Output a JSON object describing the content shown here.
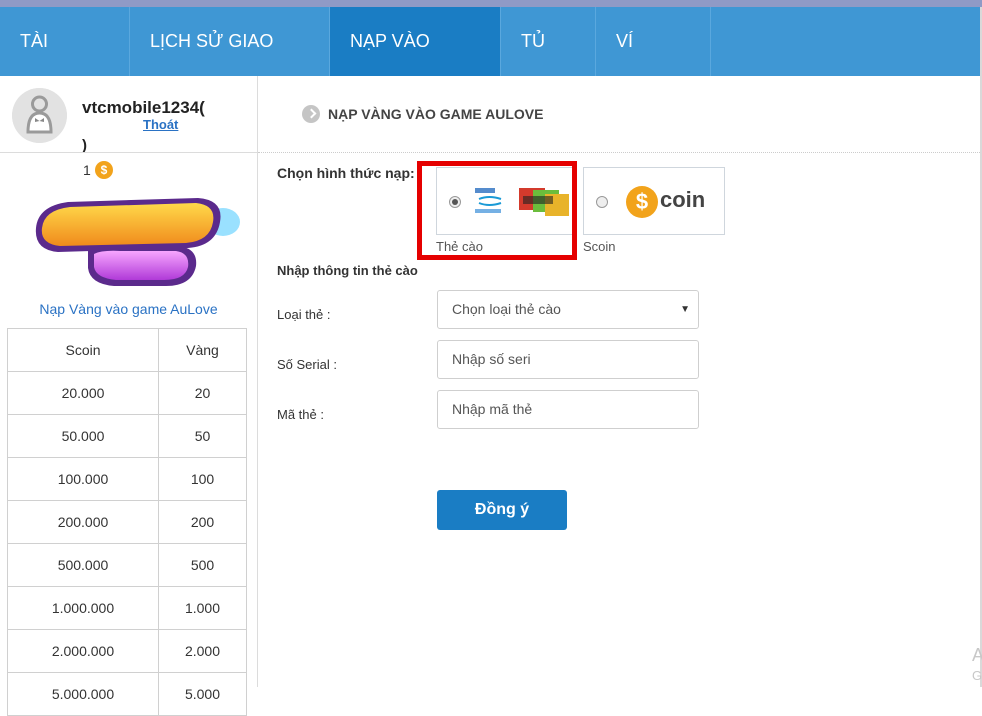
{
  "nav": {
    "items": [
      {
        "label": "TÀI KHOẢN"
      },
      {
        "label": "LỊCH SỬ GIAO DỊCH"
      },
      {
        "label": "NẠP VÀO GAME"
      },
      {
        "label": "TỦ ĐỒ"
      },
      {
        "label": "VÍ SCOIN"
      }
    ],
    "active_index": 2
  },
  "user": {
    "name": "vtcmobile1234(",
    "logout_label": "Thoát",
    "name_close": ")",
    "coin_balance": "1",
    "coin_symbol": "$"
  },
  "sidebar": {
    "game_link": "Nạp Vàng vào game AuLove",
    "table_headers": [
      "Scoin",
      "Vàng"
    ],
    "rates": [
      [
        "20.000",
        "20"
      ],
      [
        "50.000",
        "50"
      ],
      [
        "100.000",
        "100"
      ],
      [
        "200.000",
        "200"
      ],
      [
        "500.000",
        "500"
      ],
      [
        "1.000.000",
        "1.000"
      ],
      [
        "2.000.000",
        "2.000"
      ],
      [
        "5.000.000",
        "5.000"
      ]
    ]
  },
  "main": {
    "title": "NẠP VÀNG VÀO GAME AULOVE",
    "method_label": "Chọn hình thức nạp:",
    "methods": [
      {
        "caption": "Thẻ cào",
        "selected": true
      },
      {
        "caption": "Scoin",
        "selected": false,
        "logo_symbol": "$",
        "logo_text": "coin"
      }
    ],
    "section_label": "Nhập thông tin thẻ cào",
    "card_type_label": "Loại thẻ :",
    "card_type_value": "Chọn loại thẻ cào",
    "serial_label": "Số Serial :",
    "serial_placeholder": "Nhập số seri",
    "code_label": "Mã thẻ :",
    "code_placeholder": "Nhập mã thẻ",
    "submit_label": "Đồng ý"
  },
  "corner": {
    "line1": "A",
    "line2": "G"
  },
  "colors": {
    "nav_bg": "#3f97d4",
    "nav_active": "#1a7dc4",
    "link": "#2a72c4",
    "highlight": "#e50000",
    "coin": "#f2a31b"
  }
}
